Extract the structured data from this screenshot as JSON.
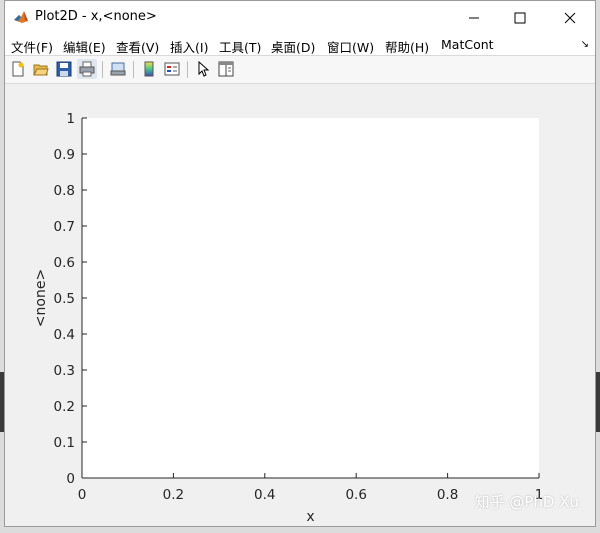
{
  "window": {
    "title": "Plot2D - x,<none>",
    "icon": "matlab-logo-icon",
    "controls": [
      "minimize-icon",
      "maximize-icon",
      "close-icon"
    ]
  },
  "menu": [
    "文件(F)",
    "编辑(E)",
    "查看(V)",
    "插入(I)",
    "工具(T)",
    "桌面(D)",
    "窗口(W)",
    "帮助(H)",
    "MatCont"
  ],
  "toolbar": [
    "new-figure-icon",
    "open-file-icon",
    "save-icon",
    "print-icon",
    "print-preview-icon",
    "colorbar-icon",
    "legend-icon",
    "select-arrow-icon",
    "plot-browser-icon"
  ],
  "chart_data": {
    "type": "line",
    "series": [],
    "xlabel": "x",
    "ylabel": "<none>",
    "xlim": [
      0,
      1
    ],
    "ylim": [
      0,
      1
    ],
    "xticks": [
      "0",
      "0.2",
      "0.4",
      "0.6",
      "0.8",
      "1"
    ],
    "yticks": [
      "0",
      "0.1",
      "0.2",
      "0.3",
      "0.4",
      "0.5",
      "0.6",
      "0.7",
      "0.8",
      "0.9",
      "1"
    ],
    "grid": false
  },
  "watermark": "知乎 @PhD Xu",
  "colors": {
    "axes_background": "#ffffff",
    "figure_background": "#f0f0f0",
    "axis_color": "#262626"
  }
}
